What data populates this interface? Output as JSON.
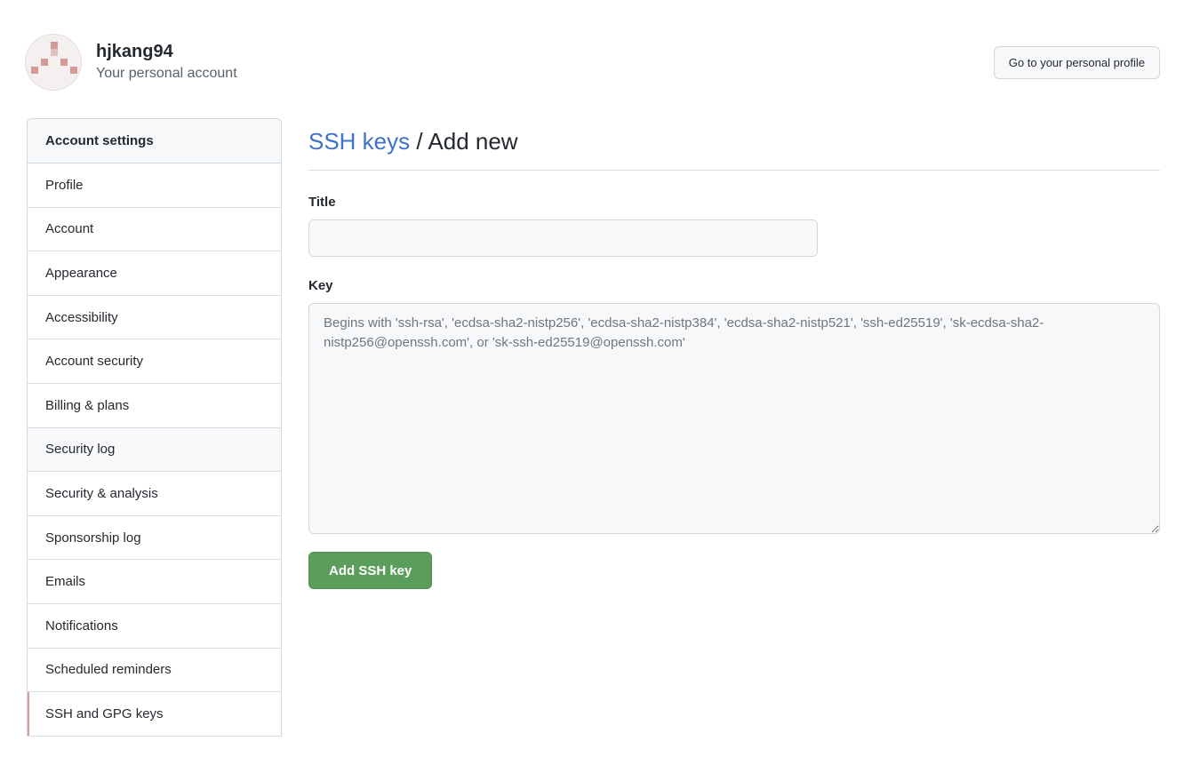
{
  "header": {
    "username": "hjkang94",
    "subtitle": "Your personal account",
    "profile_button": "Go to your personal profile"
  },
  "sidebar": {
    "heading": "Account settings",
    "selected": "SSH and GPG keys",
    "items": [
      {
        "label": "Profile"
      },
      {
        "label": "Account"
      },
      {
        "label": "Appearance"
      },
      {
        "label": "Accessibility"
      },
      {
        "label": "Account security"
      },
      {
        "label": "Billing & plans"
      },
      {
        "label": "Security log"
      },
      {
        "label": "Security & analysis"
      },
      {
        "label": "Sponsorship log"
      },
      {
        "label": "Emails"
      },
      {
        "label": "Notifications"
      },
      {
        "label": "Scheduled reminders"
      },
      {
        "label": "SSH and GPG keys"
      }
    ]
  },
  "main": {
    "breadcrumb_link": "SSH keys",
    "breadcrumb_separator": " / ",
    "breadcrumb_current": "Add new",
    "title_label": "Title",
    "title_value": "",
    "key_label": "Key",
    "key_value": "",
    "key_placeholder": "Begins with 'ssh-rsa', 'ecdsa-sha2-nistp256', 'ecdsa-sha2-nistp384', 'ecdsa-sha2-nistp521', 'ssh-ed25519', 'sk-ecdsa-sha2-nistp256@openssh.com', or 'sk-ssh-ed25519@openssh.com'",
    "submit_label": "Add SSH key"
  },
  "colors": {
    "link": "#3f72c8",
    "primary_button": "#5b9e5b",
    "selected_indicator": "#e19a8f",
    "avatar_pattern": "#d59a95"
  }
}
